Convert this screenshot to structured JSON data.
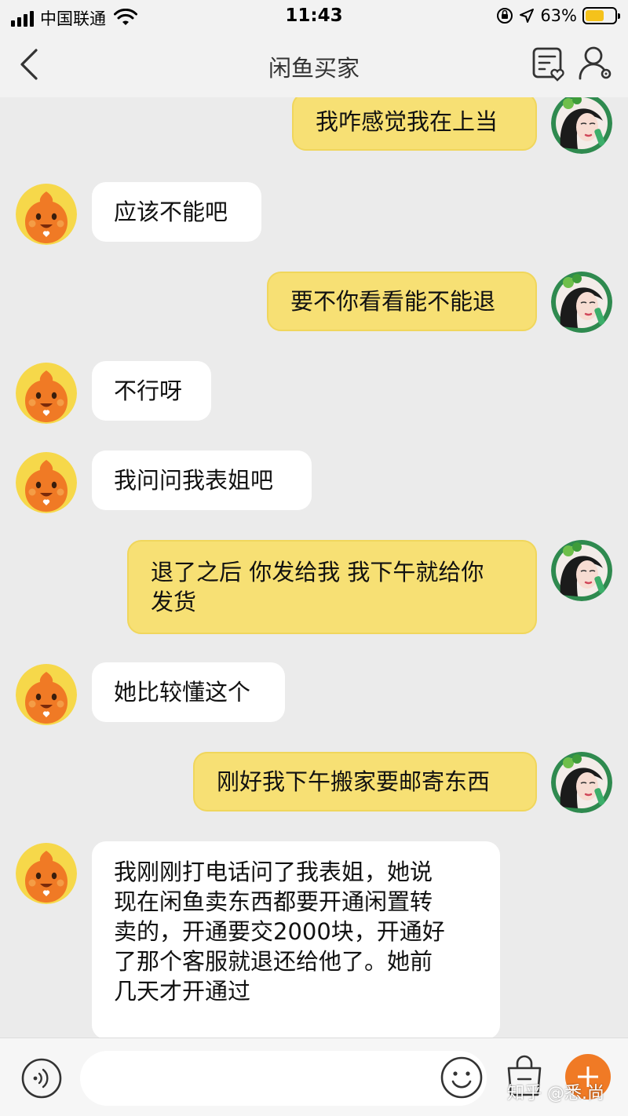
{
  "status_bar": {
    "carrier": "中国联通",
    "time": "11:43",
    "battery_percent": "63%",
    "battery_level": 0.63,
    "battery_color": "#f5c21b"
  },
  "nav": {
    "title": "闲鱼买家",
    "back_icon": "chevron-left-icon",
    "order_icon": "order-list-icon",
    "profile_icon": "user-settings-icon"
  },
  "messages": [
    {
      "side": "out",
      "text": "我咋感觉我在上当"
    },
    {
      "side": "in",
      "text": "应该不能吧"
    },
    {
      "side": "out",
      "text": "要不你看看能不能退"
    },
    {
      "side": "in",
      "text": "不行呀"
    },
    {
      "side": "in",
      "text": "我问问我表姐吧"
    },
    {
      "side": "out",
      "text": "退了之后 你发给我 我下午就给你\n发货"
    },
    {
      "side": "in",
      "text": "她比较懂这个"
    },
    {
      "side": "out",
      "text": "刚好我下午搬家要邮寄东西"
    },
    {
      "side": "in",
      "text": "我刚刚打电话问了我表姐，她说\n现在闲鱼卖东西都要开通闲置转\n卖的，开通要交2000块，开通好\n了那个客服就退还给他了。她前\n几天才开通过"
    }
  ],
  "input_bar": {
    "placeholder": "",
    "voice_icon": "voice-icon",
    "emoji_icon": "emoji-icon",
    "bag_icon": "shopping-bag-icon",
    "add_icon": "plus-icon"
  },
  "watermark": "知乎 @悉.尚",
  "colors": {
    "background": "#ebebeb",
    "outgoing_bubble": "#f7e074",
    "incoming_bubble": "#ffffff",
    "accent": "#f07a25"
  }
}
